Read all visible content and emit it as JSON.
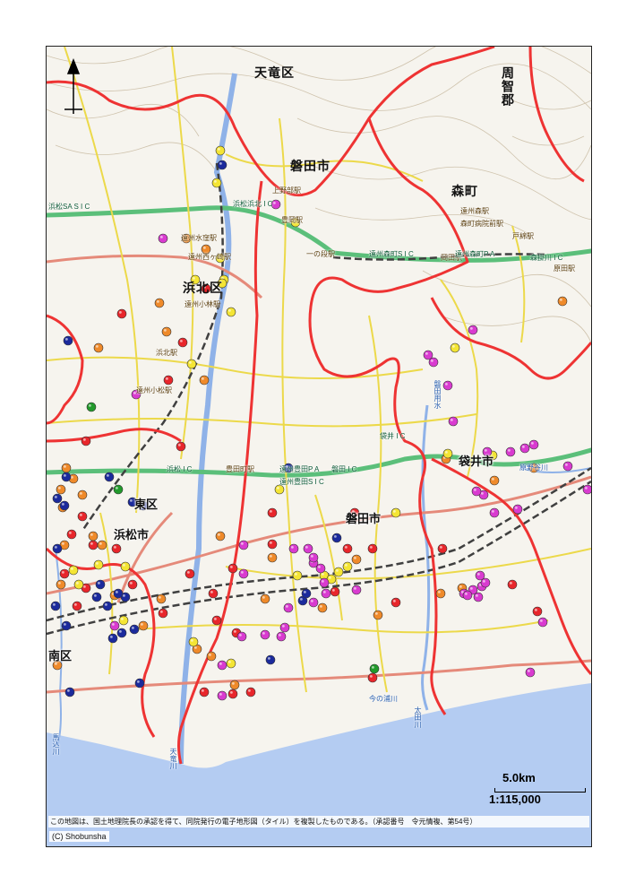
{
  "map": {
    "colors": {
      "land": "#f6f4ee",
      "sea": "#b4ccf2",
      "boundary": "#ee3333",
      "expressway": "#5bbf7a",
      "national_road": "#e58a7a",
      "local_road": "#ecd94a",
      "railway": "#404040",
      "river": "#8fb2e8",
      "terrain": "#cfc3ad"
    },
    "regions": [
      {
        "id": "tenryu-ku",
        "label": "天竜区"
      },
      {
        "id": "shuchi-gun",
        "label": "周智郡"
      },
      {
        "id": "iwata-north",
        "label": "磐田市"
      },
      {
        "id": "mori-machi",
        "label": "森町"
      },
      {
        "id": "hamakita-ku",
        "label": "浜北区"
      },
      {
        "id": "higashi-ku",
        "label": "東区"
      },
      {
        "id": "iwata-south",
        "label": "磐田市"
      },
      {
        "id": "fukuroi",
        "label": "袋井市"
      },
      {
        "id": "minami-ku",
        "label": "南区"
      },
      {
        "id": "hamamatsu",
        "label": "浜松市"
      }
    ],
    "stations": [
      {
        "id": "kamino",
        "label": "上野部駅"
      },
      {
        "id": "toyooka",
        "label": "豊岡駅"
      },
      {
        "id": "enshu-mori",
        "label": "遠州森駅"
      },
      {
        "id": "morimachi-byoin",
        "label": "森町病院前駅"
      },
      {
        "id": "totsuna",
        "label": "戸綿駅"
      },
      {
        "id": "haraya",
        "label": "原田駅"
      },
      {
        "id": "enshu-nishigasaki",
        "label": "遠州西ヶ崎駅"
      },
      {
        "id": "enshu-kobayashi",
        "label": "遠州小林駅"
      },
      {
        "id": "hamakita",
        "label": "浜北駅"
      },
      {
        "id": "enshu-kobayashi2",
        "label": "遠州小松駅"
      },
      {
        "id": "toyoda",
        "label": "豊田町駅"
      },
      {
        "id": "okada",
        "label": "岡田駅"
      },
      {
        "id": "ichinodan",
        "label": "一の段駅"
      },
      {
        "id": "tenryu-mizu",
        "label": "遠州水窪駅"
      }
    ],
    "ics": [
      {
        "id": "hamamatsu-sa",
        "label": "浜松SA S I C"
      },
      {
        "id": "hamamatsu-hamakita",
        "label": "浜松浜北 I C"
      },
      {
        "id": "enshu-mori-ic",
        "label": "遠州森町S I C"
      },
      {
        "id": "enshu-mori-pa",
        "label": "遠州森町P A"
      },
      {
        "id": "enshu-toyota",
        "label": "遠州豊田P A"
      },
      {
        "id": "iwata-ic",
        "label": "磐田 I C"
      },
      {
        "id": "enshu-toyota-sic",
        "label": "遠州豊田S I C"
      },
      {
        "id": "hamamatsu-ic",
        "label": "浜松 I C"
      },
      {
        "id": "fukuroi-ic",
        "label": "袋井 I C"
      },
      {
        "id": "mori-kakegawa",
        "label": "森掛川 I C"
      }
    ],
    "rivers": [
      {
        "id": "tenryu",
        "label": "天竜川"
      },
      {
        "id": "ota",
        "label": "太田川"
      },
      {
        "id": "bosogawa",
        "label": "原野谷川"
      },
      {
        "id": "magome",
        "label": "馬込川"
      },
      {
        "id": "imanoura",
        "label": "今の浦川"
      },
      {
        "id": "iwata-yosui",
        "label": "磐田用水"
      }
    ],
    "marker_colors": {
      "red": "#e8262b",
      "orange": "#ef8a2a",
      "yellow": "#f4e534",
      "magenta": "#d93bd0",
      "navy": "#1b2a9c",
      "green": "#229a2b"
    },
    "marker_counts": {
      "red": 34,
      "orange": 34,
      "yellow": 26,
      "magenta": 46,
      "navy": 26,
      "green": 3
    },
    "scale": {
      "distance": "5.0km",
      "ratio": "1:115,000"
    },
    "attribution": "この地図は、国土地理院長の承認を得て、同院発行の電子地形図（タイル）を複製したものである。（承認番号　令元情複、第54号）",
    "copyright": "(C) Shobunsha"
  }
}
